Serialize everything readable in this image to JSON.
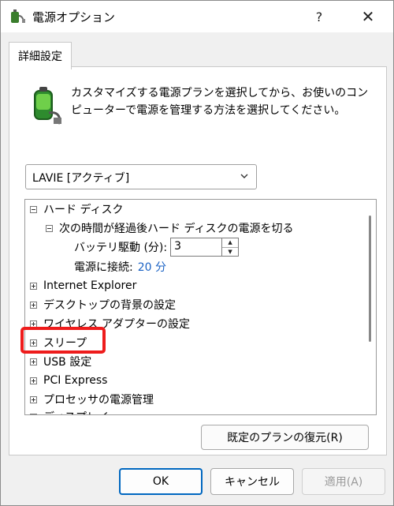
{
  "window": {
    "title": "電源オプション",
    "help": "?",
    "close": "✕"
  },
  "tabs": [
    {
      "label": "詳細設定"
    }
  ],
  "description": "カスタマイズする電源プランを選択してから、お使いのコンピューターで電源を管理する方法を選択してください。",
  "plan_select": {
    "value": "LAVIE [アクティブ]"
  },
  "tree": {
    "hard_disk": "ハード ディスク",
    "hdd_off": "次の時間が経過後ハード ディスクの電源を切る",
    "battery_label": "バッテリ駆動 (分):",
    "battery_value": "3",
    "plugged_label": "電源に接続:",
    "plugged_value": "20 分",
    "items": [
      "Internet Explorer",
      "デスクトップの背景の設定",
      "ワイヤレス アダプターの設定",
      "スリープ",
      "USB 設定",
      "PCI Express",
      "プロセッサの電源管理",
      "ディスプレイ"
    ]
  },
  "buttons": {
    "restore": "既定のプランの復元(R)",
    "ok": "OK",
    "cancel": "キャンセル",
    "apply": "適用(A)"
  },
  "colors": {
    "accent": "#0067c0",
    "link": "#1a62c4",
    "highlight": "#ee1c1c"
  }
}
